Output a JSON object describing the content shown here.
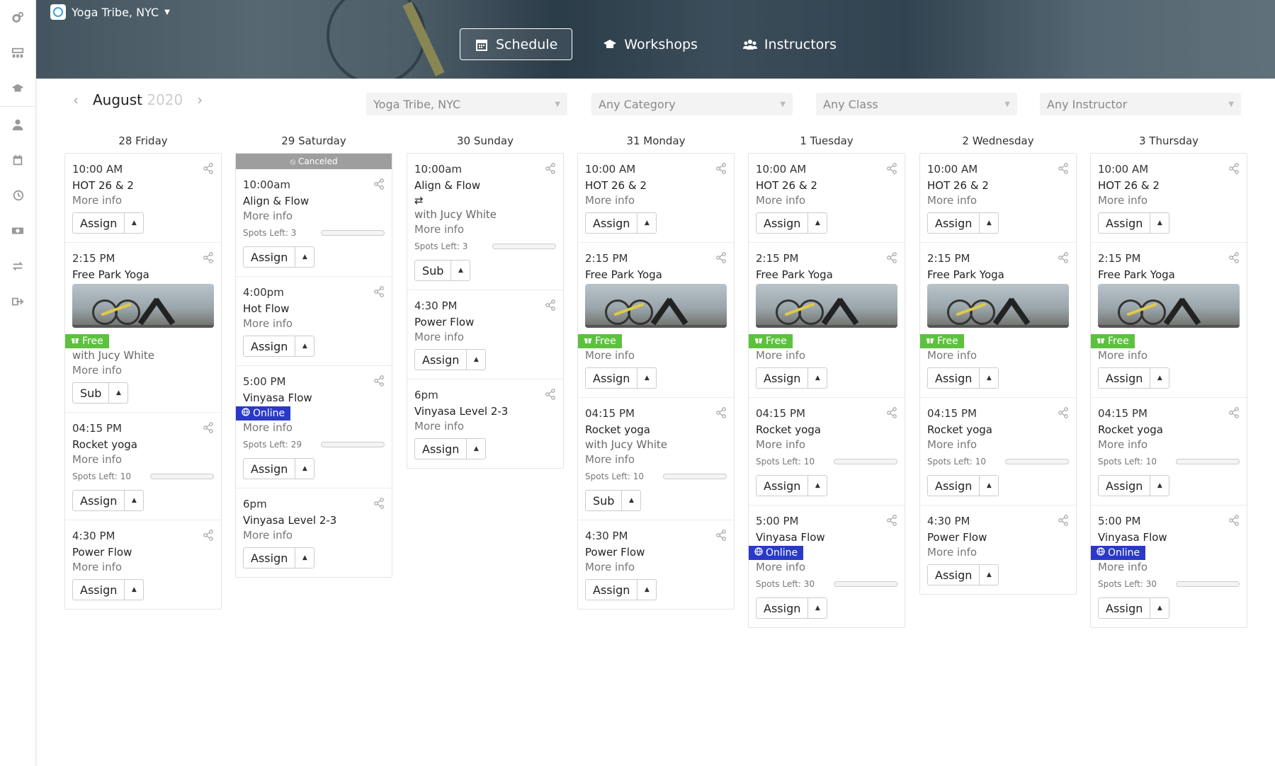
{
  "header": {
    "studio": "Yoga Tribe, NYC",
    "tabs": [
      {
        "label": "Schedule",
        "icon": "calendar-icon",
        "active": true
      },
      {
        "label": "Workshops",
        "icon": "graduation-cap-icon",
        "active": false
      },
      {
        "label": "Instructors",
        "icon": "users-icon",
        "active": false
      }
    ]
  },
  "sidebar": {
    "items": [
      "settings-icon",
      "dashboard-icon",
      "graduation-cap-icon",
      "user-icon",
      "calendar-icon",
      "history-icon",
      "money-icon",
      "exchange-icon",
      "sign-out-icon"
    ]
  },
  "toolbar": {
    "month": "August",
    "year": "2020",
    "filters": [
      "Yoga Tribe, NYC",
      "Any Category",
      "Any Class",
      "Any Instructor"
    ]
  },
  "colors": {
    "free": "#5cc23e",
    "online": "#2a39c9",
    "canceled": "#9e9e9e"
  },
  "days": [
    {
      "label": "28 Friday",
      "canceled": "",
      "classes": [
        {
          "time": "10:00 AM",
          "name": "HOT 26 & 2",
          "more": "More info",
          "action": "Assign"
        },
        {
          "time": "2:15 PM",
          "name": "Free Park Yoga",
          "image": true,
          "badge": "Free",
          "with": "with Jucy White",
          "more": "More info",
          "action": "Sub"
        },
        {
          "time": "04:15 PM",
          "name": "Rocket yoga",
          "more": "More info",
          "spots": "Spots Left: 10",
          "action": "Assign"
        },
        {
          "time": "4:30 PM",
          "name": "Power Flow",
          "more": "More info",
          "action": "Assign"
        }
      ]
    },
    {
      "label": "29 Saturday",
      "canceled": "Canceled",
      "classes": [
        {
          "time": "10:00am",
          "name": "Align & Flow",
          "more": "More info",
          "spots": "Spots Left: 3",
          "action": "Assign"
        },
        {
          "time": "4:00pm",
          "name": "Hot Flow",
          "more": "More info",
          "action": "Assign"
        },
        {
          "time": "5:00 PM",
          "name": "Vinyasa Flow",
          "badge": "Online",
          "more": "More info",
          "spots": "Spots Left: 29",
          "action": "Assign"
        },
        {
          "time": "6pm",
          "name": "Vinyasa Level 2-3",
          "more": "More info",
          "action": "Assign"
        }
      ]
    },
    {
      "label": "30 Sunday",
      "canceled": "",
      "classes": [
        {
          "time": "10:00am",
          "name": "Align & Flow",
          "swap": "⇄",
          "with": "with Jucy White",
          "more": "More info",
          "spots": "Spots Left: 3",
          "action": "Sub"
        },
        {
          "time": "4:30 PM",
          "name": "Power Flow",
          "more": "More info",
          "action": "Assign"
        },
        {
          "time": "6pm",
          "name": "Vinyasa Level 2-3",
          "more": "More info",
          "action": "Assign"
        }
      ]
    },
    {
      "label": "31 Monday",
      "canceled": "",
      "classes": [
        {
          "time": "10:00 AM",
          "name": "HOT 26 & 2",
          "more": "More info",
          "action": "Assign"
        },
        {
          "time": "2:15 PM",
          "name": "Free Park Yoga",
          "image": true,
          "badge": "Free",
          "more": "More info",
          "action": "Assign"
        },
        {
          "time": "04:15 PM",
          "name": "Rocket yoga",
          "with": "with Jucy White",
          "more": "More info",
          "spots": "Spots Left: 10",
          "action": "Sub"
        },
        {
          "time": "4:30 PM",
          "name": "Power Flow",
          "more": "More info",
          "action": "Assign"
        }
      ]
    },
    {
      "label": "1 Tuesday",
      "canceled": "",
      "classes": [
        {
          "time": "10:00 AM",
          "name": "HOT 26 & 2",
          "more": "More info",
          "action": "Assign"
        },
        {
          "time": "2:15 PM",
          "name": "Free Park Yoga",
          "image": true,
          "badge": "Free",
          "more": "More info",
          "action": "Assign"
        },
        {
          "time": "04:15 PM",
          "name": "Rocket yoga",
          "more": "More info",
          "spots": "Spots Left: 10",
          "action": "Assign"
        },
        {
          "time": "5:00 PM",
          "name": "Vinyasa Flow",
          "badge": "Online",
          "more": "More info",
          "spots": "Spots Left: 30",
          "action": "Assign"
        }
      ]
    },
    {
      "label": "2 Wednesday",
      "canceled": "",
      "classes": [
        {
          "time": "10:00 AM",
          "name": "HOT 26 & 2",
          "more": "More info",
          "action": "Assign"
        },
        {
          "time": "2:15 PM",
          "name": "Free Park Yoga",
          "image": true,
          "badge": "Free",
          "more": "More info",
          "action": "Assign"
        },
        {
          "time": "04:15 PM",
          "name": "Rocket yoga",
          "more": "More info",
          "spots": "Spots Left: 10",
          "action": "Assign"
        },
        {
          "time": "4:30 PM",
          "name": "Power Flow",
          "more": "More info",
          "action": "Assign"
        }
      ]
    },
    {
      "label": "3 Thursday",
      "canceled": "",
      "classes": [
        {
          "time": "10:00 AM",
          "name": "HOT 26 & 2",
          "more": "More info",
          "action": "Assign"
        },
        {
          "time": "2:15 PM",
          "name": "Free Park Yoga",
          "image": true,
          "badge": "Free",
          "more": "More info",
          "action": "Assign"
        },
        {
          "time": "04:15 PM",
          "name": "Rocket yoga",
          "more": "More info",
          "spots": "Spots Left: 10",
          "action": "Assign"
        },
        {
          "time": "5:00 PM",
          "name": "Vinyasa Flow",
          "badge": "Online",
          "more": "More info",
          "spots": "Spots Left: 30",
          "action": "Assign"
        }
      ]
    }
  ]
}
